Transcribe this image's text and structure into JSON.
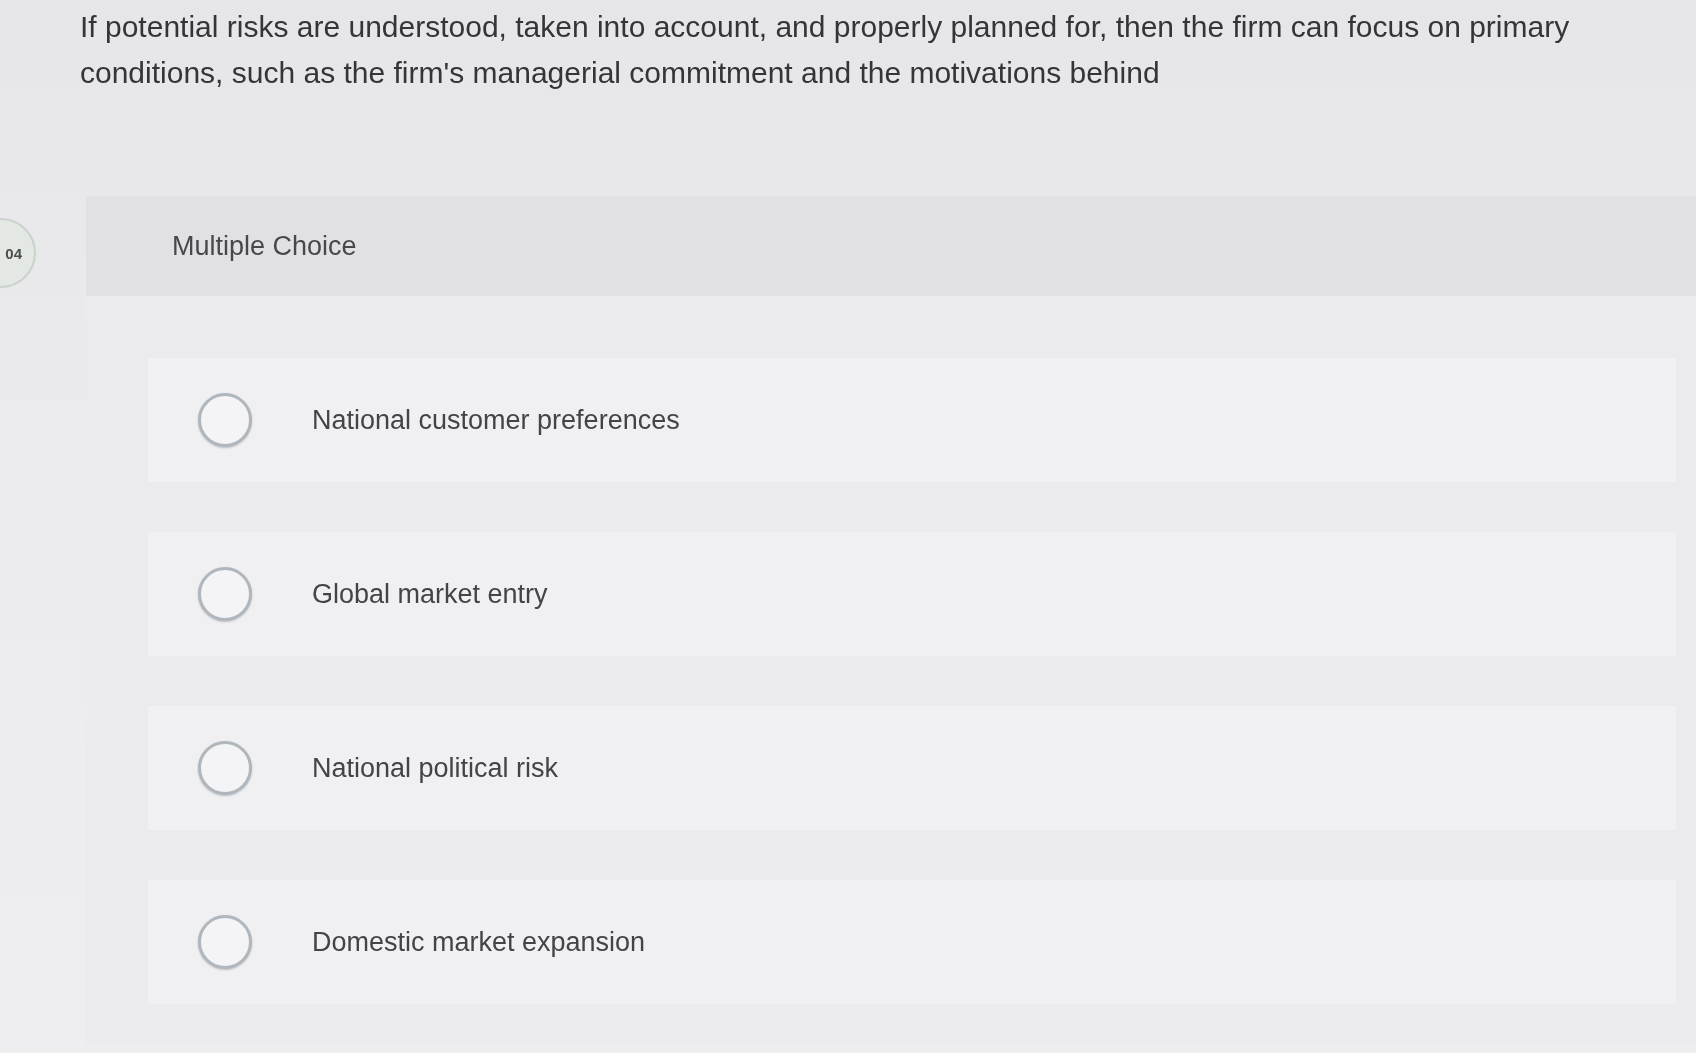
{
  "question": {
    "text": "If potential risks are understood, taken into account, and properly planned for, then the firm can focus on primary conditions, such as the firm's managerial commitment and the motivations behind"
  },
  "item": {
    "number": "04",
    "type_label": "Multiple Choice"
  },
  "options": [
    {
      "label": "National customer preferences",
      "selected": false
    },
    {
      "label": "Global market entry",
      "selected": false
    },
    {
      "label": "National political risk",
      "selected": false
    },
    {
      "label": "Domestic market expansion",
      "selected": false
    }
  ]
}
